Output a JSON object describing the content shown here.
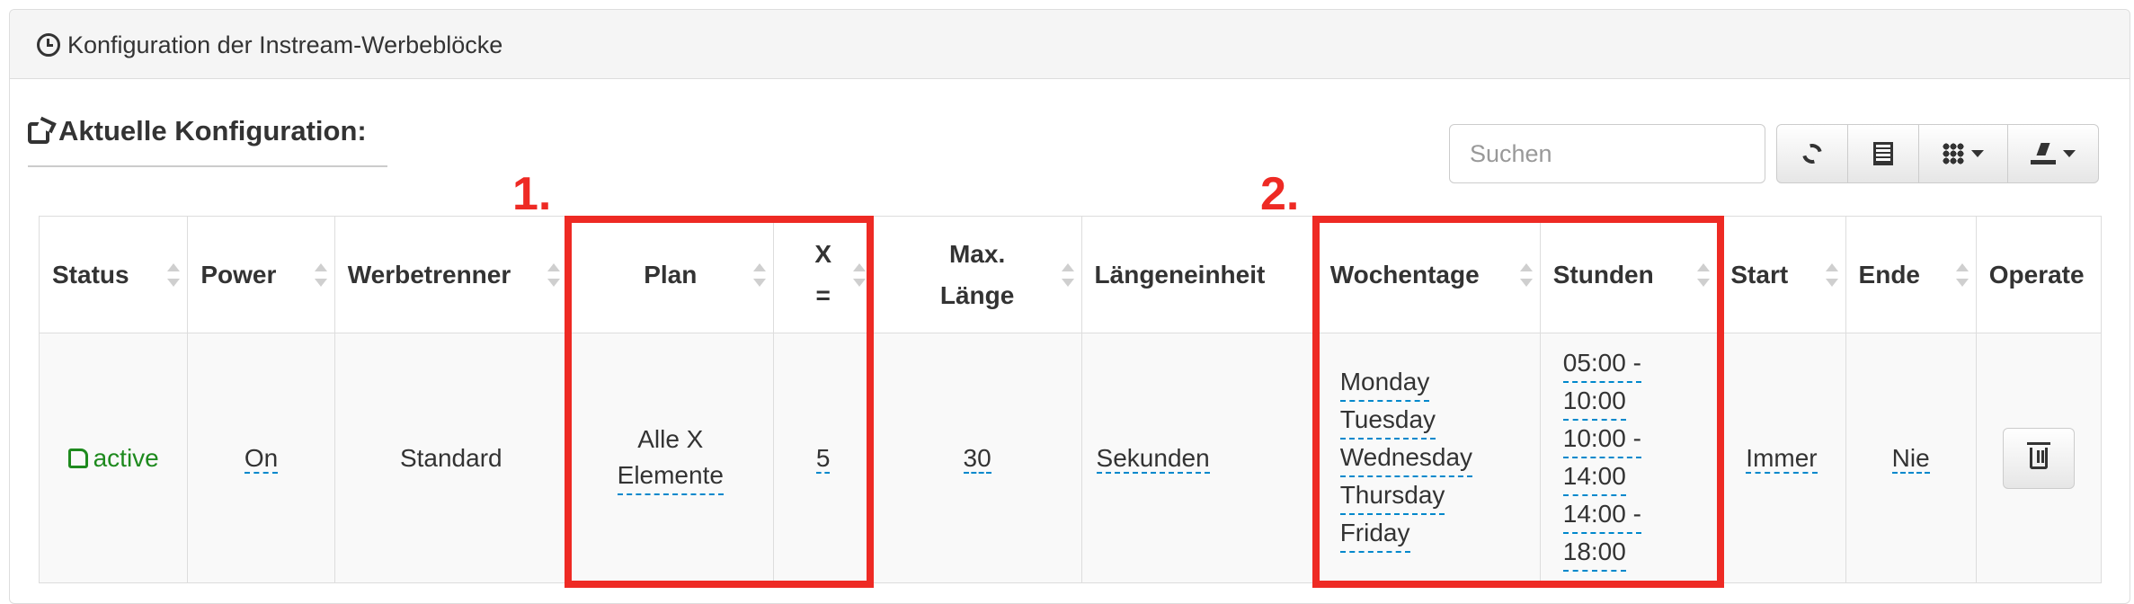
{
  "panel": {
    "title": "Konfiguration der Instream-Werbeblöcke"
  },
  "section": {
    "title": "Aktuelle Konfiguration:"
  },
  "search": {
    "placeholder": "Suchen"
  },
  "toolbar": {
    "icons": [
      "refresh-icon",
      "list-icon",
      "grid-icon",
      "export-icon"
    ]
  },
  "table": {
    "headers": [
      [
        "Status"
      ],
      [
        "Power"
      ],
      [
        "Werbetrenner"
      ],
      [
        "Plan"
      ],
      [
        "X",
        "="
      ],
      [
        "Max.",
        "Länge"
      ],
      [
        "Längeneinheit"
      ],
      [
        "Wochentage"
      ],
      [
        "Stunden"
      ],
      [
        "Start"
      ],
      [
        "Ende"
      ],
      [
        "Operate"
      ]
    ],
    "row": {
      "status": "active",
      "power": "On",
      "werbetrenner": "Standard",
      "plan": [
        "Alle X",
        "Elemente"
      ],
      "x": "5",
      "max_laenge": "30",
      "laengeneinheit": "Sekunden",
      "wochentage": [
        "Monday",
        "Tuesday",
        "Wednesday",
        "Thursday",
        "Friday"
      ],
      "stunden": [
        "05:00 -",
        "10:00",
        "10:00 -",
        "14:00",
        "14:00 -",
        "18:00"
      ],
      "start": "Immer",
      "ende": "Nie"
    }
  },
  "annotations": {
    "label_1": "1.",
    "label_2": "2.",
    "color": "#ee2a24"
  }
}
